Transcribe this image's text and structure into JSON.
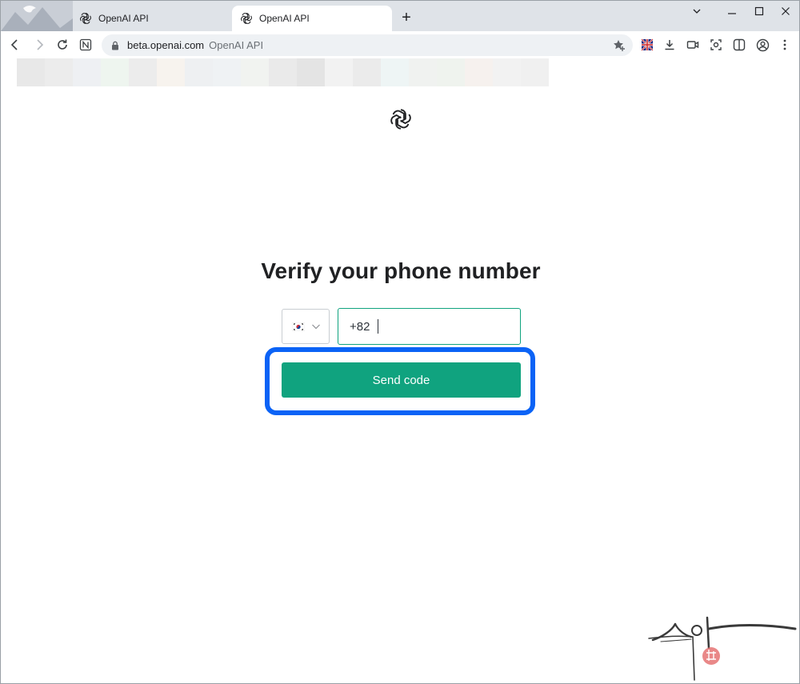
{
  "browser": {
    "tabs": [
      {
        "title": "OpenAI API",
        "active": false
      },
      {
        "title": "OpenAI API",
        "active": true
      }
    ],
    "new_tab_label": "+",
    "address": {
      "host": "beta.openai.com",
      "page_title": "OpenAI API"
    }
  },
  "page": {
    "heading": "Verify your phone number",
    "country_code": "+82",
    "selected_country_flag": "kr-flag-icon",
    "send_button_label": "Send code"
  },
  "colors": {
    "accent_green": "#10a37f",
    "highlight_blue": "#0b63f6"
  }
}
